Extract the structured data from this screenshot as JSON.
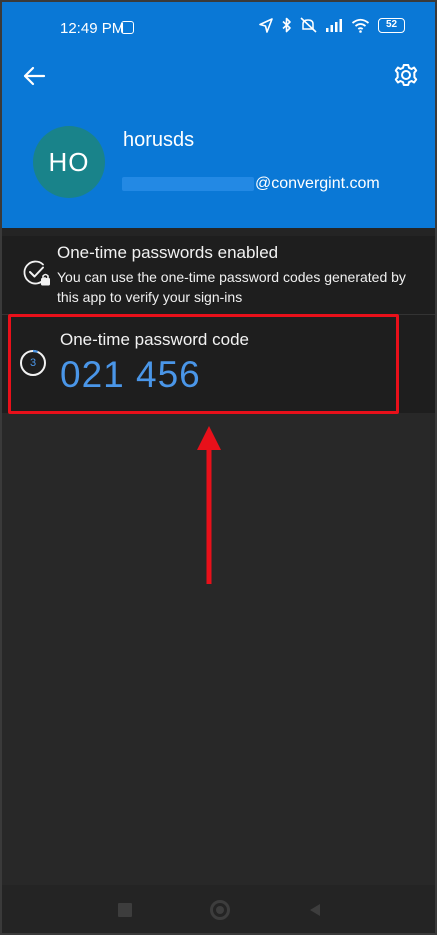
{
  "status_bar": {
    "time": "12:49 PM",
    "notification_badge": "SB",
    "battery": "52",
    "icons": [
      "location-arrow-icon",
      "bluetooth-icon",
      "silent-icon",
      "signal-icon",
      "wifi-icon",
      "battery-icon"
    ]
  },
  "top_bar": {
    "back_icon": "arrow-left-icon",
    "settings_icon": "gear-icon"
  },
  "account": {
    "initials": "HO",
    "name": "horusds",
    "email": "@convergint.com"
  },
  "enabled_section": {
    "title": "One-time passwords enabled",
    "description": "You can use the one-time password codes generated by this app to verify your sign-ins"
  },
  "otp_section": {
    "label": "One-time password code",
    "code": "021 456",
    "timer_seconds": "3"
  },
  "colors": {
    "header_blue": "#0a78d6",
    "avatar_teal": "#19838a",
    "code_blue": "#4a96e8",
    "highlight_red": "#e8101a"
  }
}
